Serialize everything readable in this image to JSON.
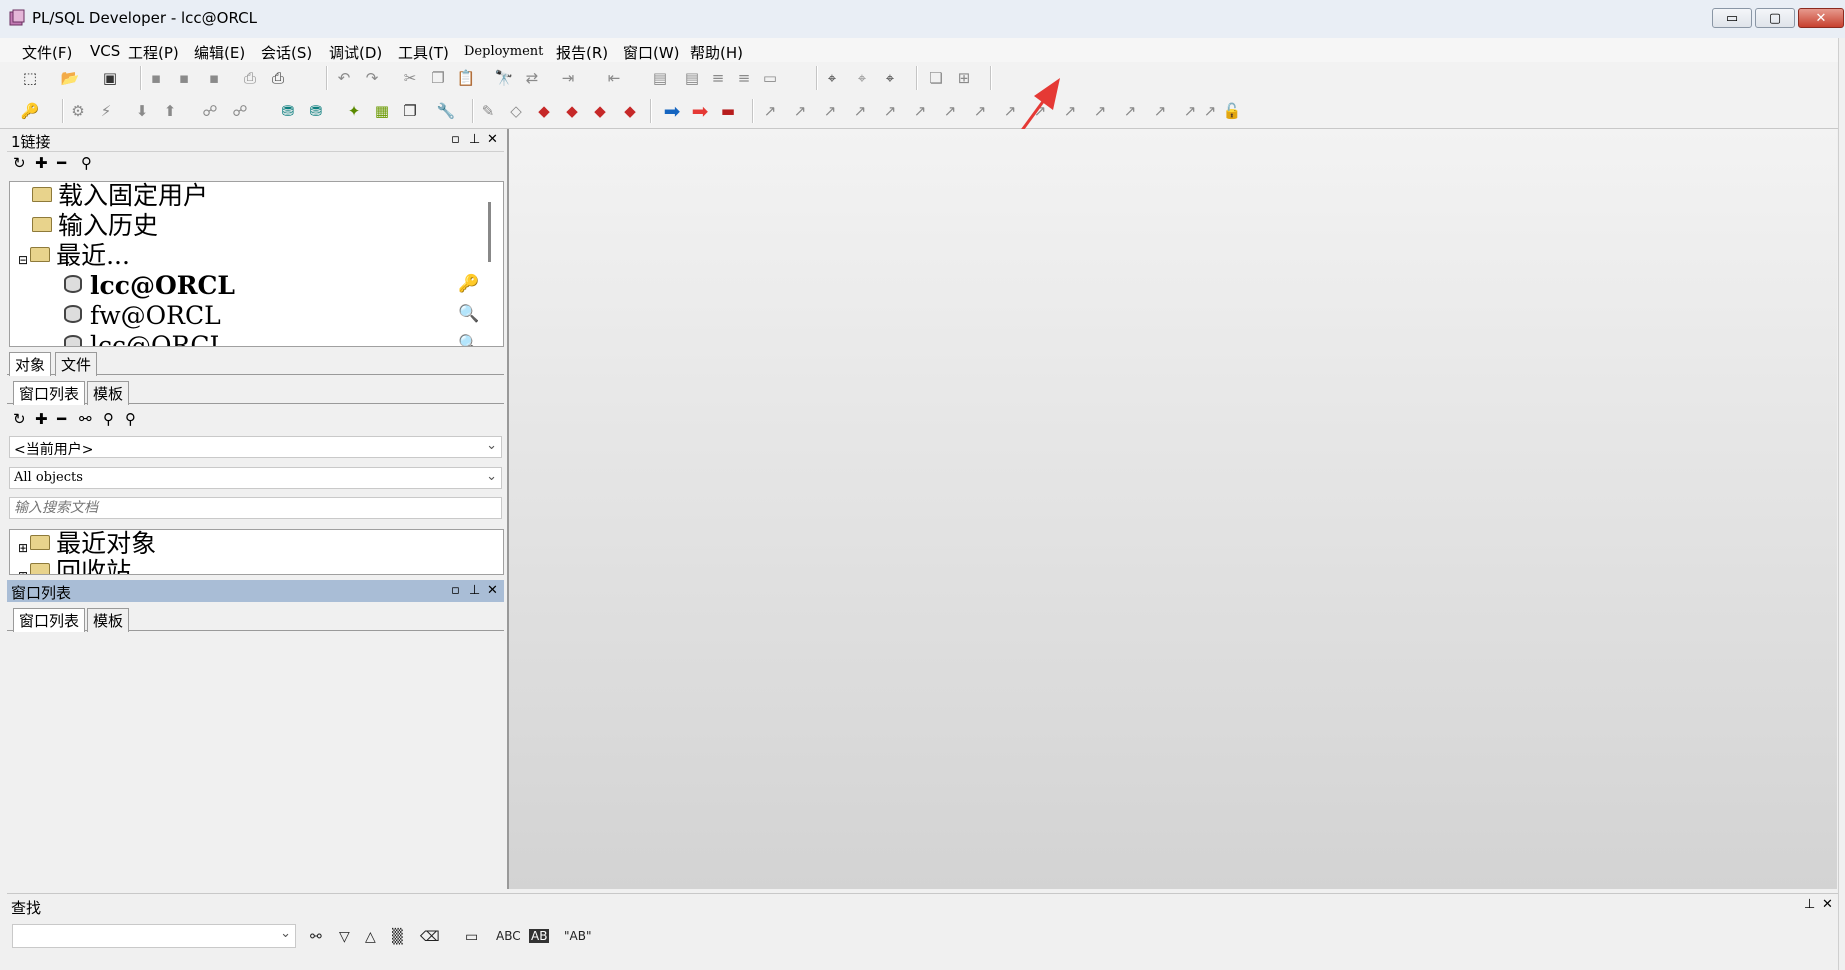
{
  "window": {
    "title": "PL/SQL Developer - lcc@ORCL",
    "controls": {
      "minimize": "▭",
      "maximize": "▢",
      "close": "✕"
    }
  },
  "menu": [
    {
      "label": "文件(F)"
    },
    {
      "label": "VCS"
    },
    {
      "label": "工程(P)"
    },
    {
      "label": "编辑(E)"
    },
    {
      "label": "会话(S)"
    },
    {
      "label": "调试(D)"
    },
    {
      "label": "工具(T)"
    },
    {
      "label": "Deployment"
    },
    {
      "label": "报告(R)"
    },
    {
      "label": "窗口(W)"
    },
    {
      "label": "帮助(H)"
    }
  ],
  "connections_panel": {
    "title": "1链接",
    "tree": {
      "fixed_users": "载入固定用户",
      "history": "输入历史",
      "recent": "最近...",
      "conn1": "lcc@ORCL",
      "conn2": "fw@ORCL",
      "conn3": "lcc@ORCL"
    }
  },
  "objects_panel": {
    "tabs": {
      "objects": "对象",
      "files": "文件"
    },
    "subtabs": {
      "window_list": "窗口列表",
      "templates": "模板"
    },
    "user_select": "<当前用户>",
    "type_select": "All objects",
    "search_placeholder": "输入搜索文档",
    "tree": {
      "recent_objects": "最近对象",
      "recycle_bin": "回收站"
    }
  },
  "window_list_panel": {
    "title": "窗口列表",
    "subtabs": {
      "window_list": "窗口列表",
      "templates": "模板"
    }
  },
  "find_panel": {
    "title": "查找",
    "buttons": {
      "abc": "ABC",
      "ab_whole": "AB",
      "ab_quoted": "\"AB\""
    }
  },
  "colors": {
    "accent_red": "#e53935",
    "panel_header_blue": "#a9bdd6",
    "mdi_bg": "#dcdcdc"
  },
  "icons": [
    "new-icon",
    "open-icon",
    "save-icon",
    "print-icon",
    "undo-icon",
    "redo-icon",
    "cut-icon",
    "copy-icon",
    "paste-icon",
    "find-icon",
    "oracle-icon",
    "pdf-icon",
    "info-icon"
  ]
}
